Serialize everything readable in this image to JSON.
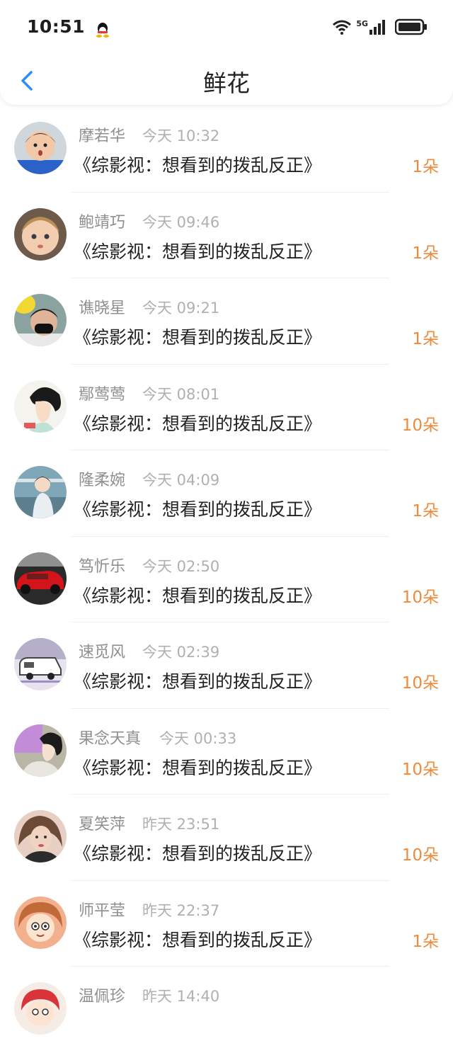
{
  "status_bar": {
    "time": "10:51",
    "network": "5G"
  },
  "header": {
    "title": "鲜花"
  },
  "items": [
    {
      "name": "摩若华",
      "date": "今天 10:32",
      "work": "《综影视：想看到的拨乱反正》",
      "count": "1朵",
      "avatar": "child-boy"
    },
    {
      "name": "鲍靖巧",
      "date": "今天 09:46",
      "work": "《综影视：想看到的拨乱反正》",
      "count": "1朵",
      "avatar": "baby"
    },
    {
      "name": "谯晓星",
      "date": "今天 09:21",
      "work": "《综影视：想看到的拨乱反正》",
      "count": "1朵",
      "avatar": "masked-man"
    },
    {
      "name": "鄢莺莺",
      "date": "今天 08:01",
      "work": "《综影视：想看到的拨乱反正》",
      "count": "10朵",
      "avatar": "anime-girl"
    },
    {
      "name": "隆柔婉",
      "date": "今天 04:09",
      "work": "《综影视：想看到的拨乱反正》",
      "count": "1朵",
      "avatar": "girl-lake"
    },
    {
      "name": "笃忻乐",
      "date": "今天 02:50",
      "work": "《综影视：想看到的拨乱反正》",
      "count": "10朵",
      "avatar": "red-car"
    },
    {
      "name": "速觅风",
      "date": "今天 02:39",
      "work": "《综影视：想看到的拨乱反正》",
      "count": "10朵",
      "avatar": "camper"
    },
    {
      "name": "果念天真",
      "date": "今天 00:33",
      "work": "《综影视：想看到的拨乱反正》",
      "count": "10朵",
      "avatar": "illustration-girl"
    },
    {
      "name": "夏笑萍",
      "date": "昨天 23:51",
      "work": "《综影视：想看到的拨乱反正》",
      "count": "10朵",
      "avatar": "woman-portrait"
    },
    {
      "name": "师平莹",
      "date": "昨天 22:37",
      "work": "《综影视：想看到的拨乱反正》",
      "count": "1朵",
      "avatar": "cartoon-girl"
    },
    {
      "name": "温佩珍",
      "date": "昨天 14:40",
      "work": "",
      "count": "",
      "avatar": "cartoon-red"
    }
  ]
}
